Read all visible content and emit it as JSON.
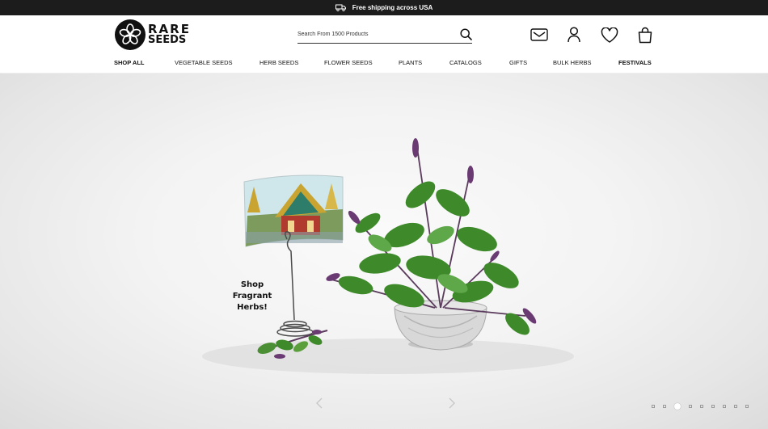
{
  "promo": {
    "text": "Free shipping across USA",
    "icon": "truck-icon"
  },
  "logo": {
    "line1": "RARE",
    "line2": "SEEDS"
  },
  "search": {
    "placeholder": "Search From 1500 Products",
    "icon": "search-icon"
  },
  "header_icons": [
    "mail-icon",
    "account-icon",
    "wishlist-heart-icon",
    "cart-bag-icon"
  ],
  "nav": {
    "items": [
      {
        "label": "SHOP ALL",
        "bold": true
      },
      {
        "label": "VEGETABLE SEEDS",
        "bold": false
      },
      {
        "label": "HERB SEEDS",
        "bold": false
      },
      {
        "label": "FLOWER SEEDS",
        "bold": false
      },
      {
        "label": "PLANTS",
        "bold": false
      },
      {
        "label": "CATALOGS",
        "bold": false
      },
      {
        "label": "GIFTS",
        "bold": false
      },
      {
        "label": "BULK HERBS",
        "bold": false
      },
      {
        "label": "FESTIVALS",
        "bold": true
      }
    ]
  },
  "hero": {
    "caption_lines": [
      "Shop",
      "Fragrant",
      "Herbs!"
    ],
    "slider": {
      "slide_count": 9,
      "active_index": 2
    }
  },
  "colors": {
    "promo_bg": "#1c1c1c",
    "leaf": "#3e8a2a",
    "flower": "#6a3a72"
  }
}
